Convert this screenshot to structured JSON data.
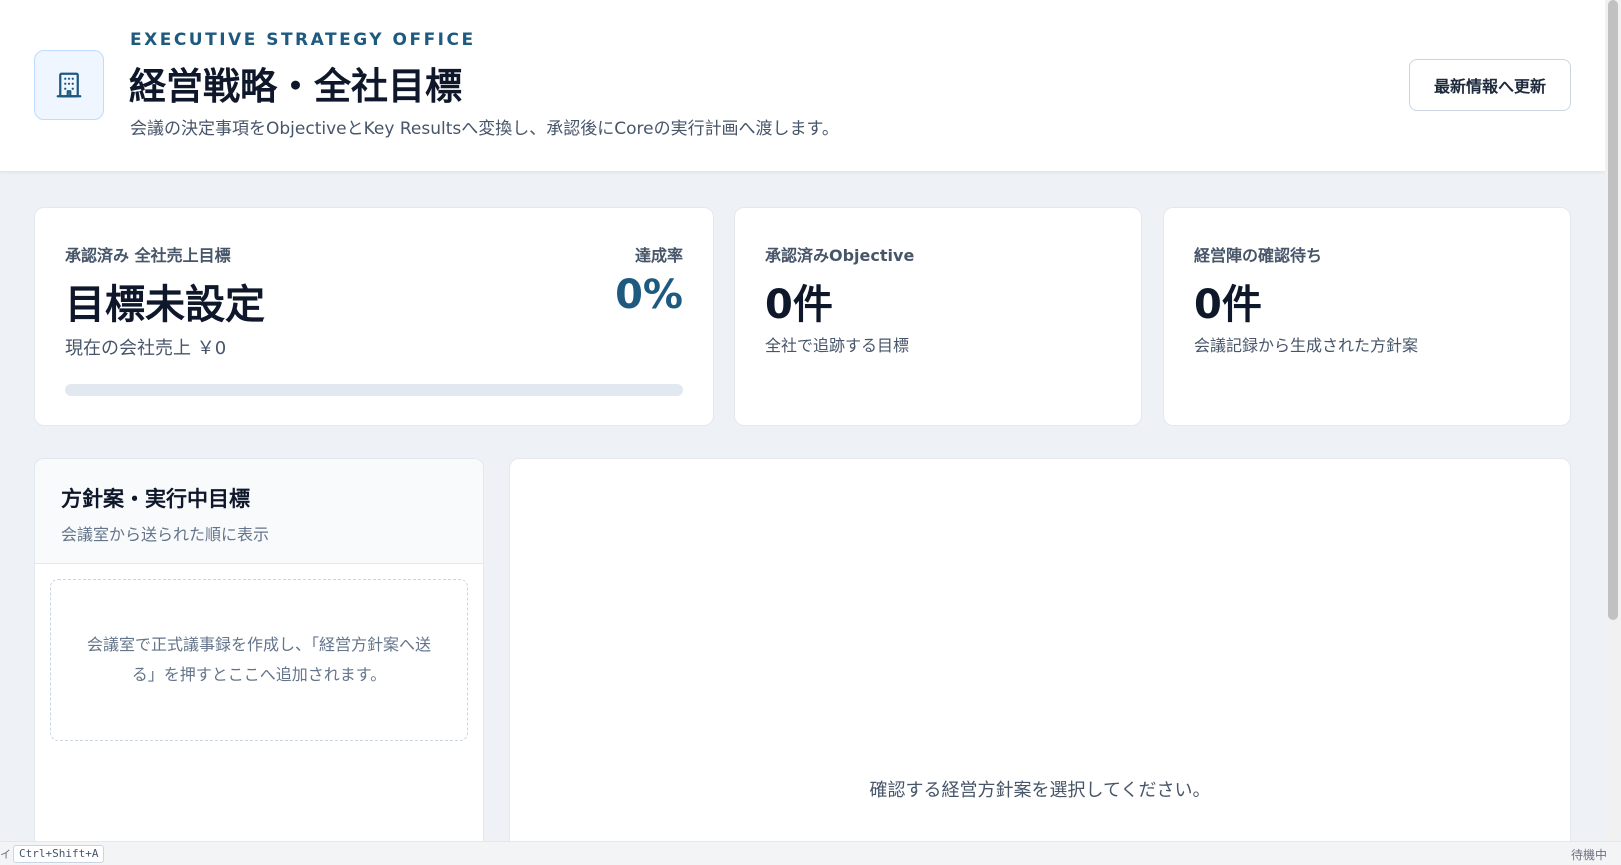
{
  "header": {
    "eyebrow": "EXECUTIVE STRATEGY OFFICE",
    "title": "経営戦略・全社目標",
    "description": "会議の決定事項をObjectiveとKey Resultsへ変換し、承認後にCoreの実行計画へ渡します。",
    "icon": "building-icon",
    "refresh_label": "最新情報へ更新"
  },
  "kpis": {
    "revenue": {
      "label": "承認済み 全社売上目標",
      "value": "目標未設定",
      "sub": "現在の会社売上 ￥0",
      "rate_label": "達成率",
      "rate_value": "0%",
      "progress_percent": 0
    },
    "objectives": {
      "label": "承認済みObjective",
      "value": "0件",
      "sub": "全社で追跡する目標"
    },
    "pending": {
      "label": "経営陣の確認待ち",
      "value": "0件",
      "sub": "会議記録から生成された方針案"
    }
  },
  "list_panel": {
    "title": "方針案・実行中目標",
    "subtitle": "会議室から送られた順に表示",
    "empty_message": "会議室で正式議事録を作成し、「経営方針案へ送る」を押すとここへ追加されます。"
  },
  "detail_panel": {
    "empty_message": "確認する経営方針案を選択してください。"
  },
  "statusbar": {
    "prefix": "イ",
    "shortcut": "Ctrl+Shift+A",
    "status": "待機中"
  },
  "colors": {
    "accent": "#1e5a80",
    "background": "#eef2f6",
    "card": "#ffffff",
    "border": "#e2e8f0"
  }
}
